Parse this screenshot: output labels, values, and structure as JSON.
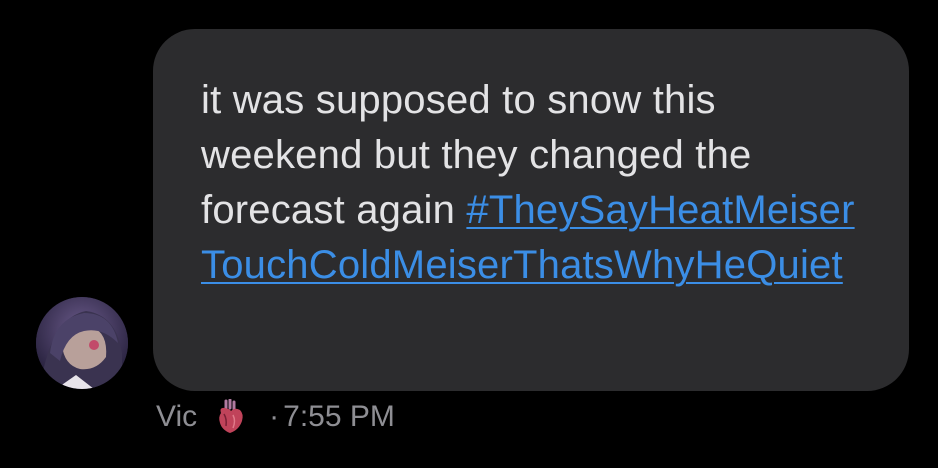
{
  "message": {
    "text": "it was supposed to snow this weekend but they changed the forecast again ",
    "hashtag": "#TheySayHeatMeiserTouchColdMeiserThatsWhyHeQuiet"
  },
  "meta": {
    "sender": "Vic",
    "sender_badge_icon": "anatomical-heart-icon",
    "separator": "·",
    "time": "7:55 PM"
  },
  "colors": {
    "background": "#000000",
    "bubble": "#2c2c2e",
    "text": "#e3e3e5",
    "link": "#3b8ee6",
    "meta": "#8e8e93"
  }
}
